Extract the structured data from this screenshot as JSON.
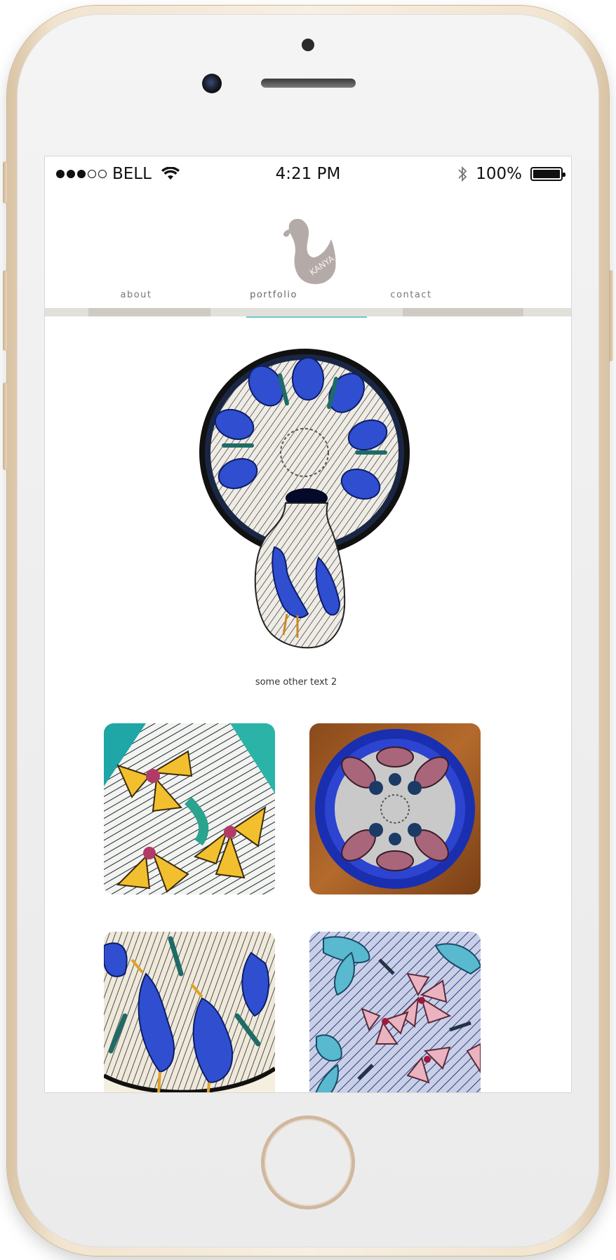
{
  "status_bar": {
    "carrier": "BELL",
    "time": "4:21 PM",
    "battery": "100%"
  },
  "site": {
    "logo_alt": "swan-logo",
    "nav": [
      {
        "label": "about",
        "active": false
      },
      {
        "label": "portfolio",
        "active": true
      },
      {
        "label": "contact",
        "active": false
      }
    ],
    "accent_color": "#6fc6cf"
  },
  "portfolio": {
    "hero_caption": "some other text 2",
    "thumbnails": [
      {
        "name": "yellow-flowers-plate"
      },
      {
        "name": "duck-bowl"
      },
      {
        "name": "blue-herons-plate"
      },
      {
        "name": "hummingbird-plate"
      }
    ]
  }
}
